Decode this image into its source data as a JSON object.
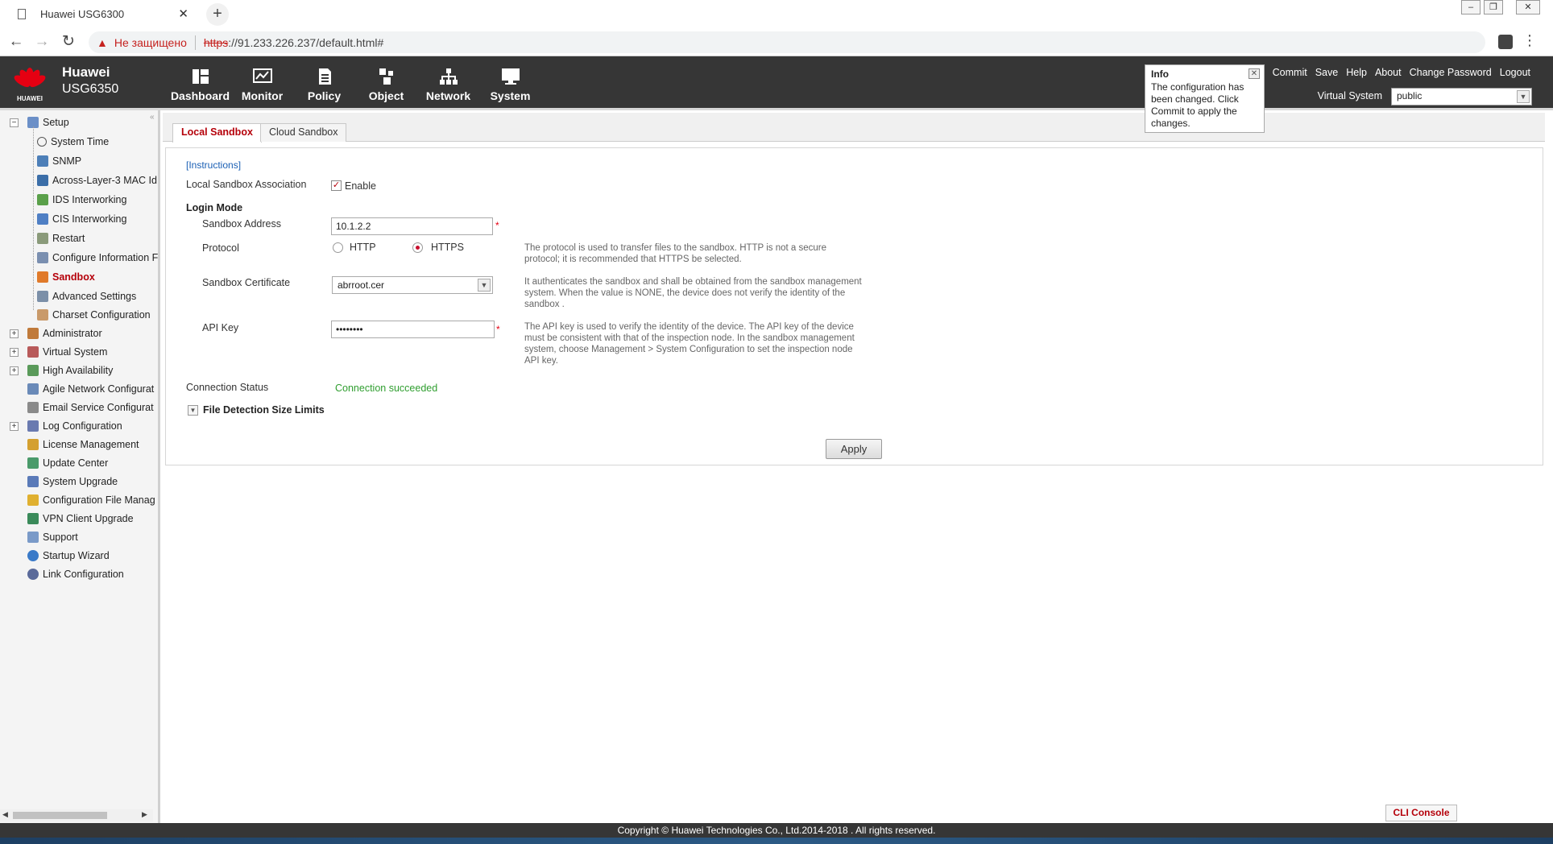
{
  "browser": {
    "tab_title": "Huawei USG6300",
    "tab_close": "✕",
    "new_tab": "+",
    "security_label": "Не защищено",
    "url_scheme": "https",
    "url_rest": "://91.233.226.237/default.html#"
  },
  "header": {
    "brand_line1": "Huawei",
    "brand_line2": "USG6350",
    "logo_text": "HUAWEI",
    "nav": [
      {
        "label": "Dashboard",
        "icon": "dashboard-icon"
      },
      {
        "label": "Monitor",
        "icon": "monitor-icon"
      },
      {
        "label": "Policy",
        "icon": "policy-icon"
      },
      {
        "label": "Object",
        "icon": "object-icon"
      },
      {
        "label": "Network",
        "icon": "network-icon"
      },
      {
        "label": "System",
        "icon": "system-icon"
      }
    ],
    "actions": [
      "Commit",
      "Save",
      "Help",
      "About",
      "Change Password",
      "Logout"
    ],
    "virtual_system_label": "Virtual System",
    "virtual_system_value": "public"
  },
  "info_popup": {
    "title": "Info",
    "message": "The configuration has been changed. Click Commit to apply the changes."
  },
  "sidebar": {
    "root": "Setup",
    "children": [
      {
        "label": "System Time",
        "icon": "clock-icon"
      },
      {
        "label": "SNMP",
        "icon": "snmp-icon"
      },
      {
        "label": "Across-Layer-3 MAC Id",
        "icon": "monitor-icon"
      },
      {
        "label": "IDS Interworking",
        "icon": "shield-icon"
      },
      {
        "label": "CIS Interworking",
        "icon": "shield-icon"
      },
      {
        "label": "Restart",
        "icon": "restart-icon"
      },
      {
        "label": "Configure Information F",
        "icon": "info-icon"
      },
      {
        "label": "Sandbox",
        "icon": "sandbox-icon"
      },
      {
        "label": "Advanced Settings",
        "icon": "settings-icon"
      },
      {
        "label": "Charset Configuration",
        "icon": "charset-icon"
      }
    ],
    "top_items": [
      {
        "label": "Administrator",
        "expandable": true
      },
      {
        "label": "Virtual System",
        "expandable": true
      },
      {
        "label": "High Availability",
        "expandable": true
      },
      {
        "label": "Agile Network Configurat",
        "expandable": false
      },
      {
        "label": "Email Service Configurat",
        "expandable": false
      },
      {
        "label": "Log Configuration",
        "expandable": true
      },
      {
        "label": "License Management",
        "expandable": false
      },
      {
        "label": "Update Center",
        "expandable": false
      },
      {
        "label": "System Upgrade",
        "expandable": false
      },
      {
        "label": "Configuration File Manag",
        "expandable": false
      },
      {
        "label": "VPN Client Upgrade",
        "expandable": false
      },
      {
        "label": "Support",
        "expandable": false
      },
      {
        "label": "Startup Wizard",
        "expandable": false
      },
      {
        "label": "Link Configuration",
        "expandable": false
      }
    ]
  },
  "tabs": [
    "Local Sandbox",
    "Cloud Sandbox"
  ],
  "form": {
    "instructions": "[Instructions]",
    "association_label": "Local Sandbox Association",
    "association_checkbox": "Enable",
    "login_mode": "Login Mode",
    "address_label": "Sandbox Address",
    "address_value": "10.1.2.2",
    "protocol_label": "Protocol",
    "protocol_options": [
      "HTTP",
      "HTTPS"
    ],
    "protocol_selected": "HTTPS",
    "protocol_help": "The protocol is used to transfer files to the sandbox. HTTP is not a secure protocol; it is recommended that HTTPS be selected.",
    "cert_label": "Sandbox Certificate",
    "cert_value": "abrroot.cer",
    "cert_help": "It authenticates the sandbox and shall be obtained from the sandbox management system. When the value is NONE, the device does not verify the identity of the sandbox .",
    "apikey_label": "API Key",
    "apikey_value": "••••••••",
    "apikey_help": "The API key is used to verify the identity of the device. The API key of the device must be consistent with that of the inspection node. In the sandbox management system, choose Management > System Configuration to set the inspection node API key.",
    "status_label": "Connection Status",
    "status_value": "Connection succeeded",
    "file_limits": "File Detection Size Limits",
    "apply": "Apply"
  },
  "cli_console": "CLI Console",
  "footer": "Copyright © Huawei Technologies Co., Ltd.2014-2018 . All rights reserved.",
  "colors": {
    "accent": "#b5000a",
    "header_bg": "#363636",
    "success": "#2f9e2f"
  }
}
